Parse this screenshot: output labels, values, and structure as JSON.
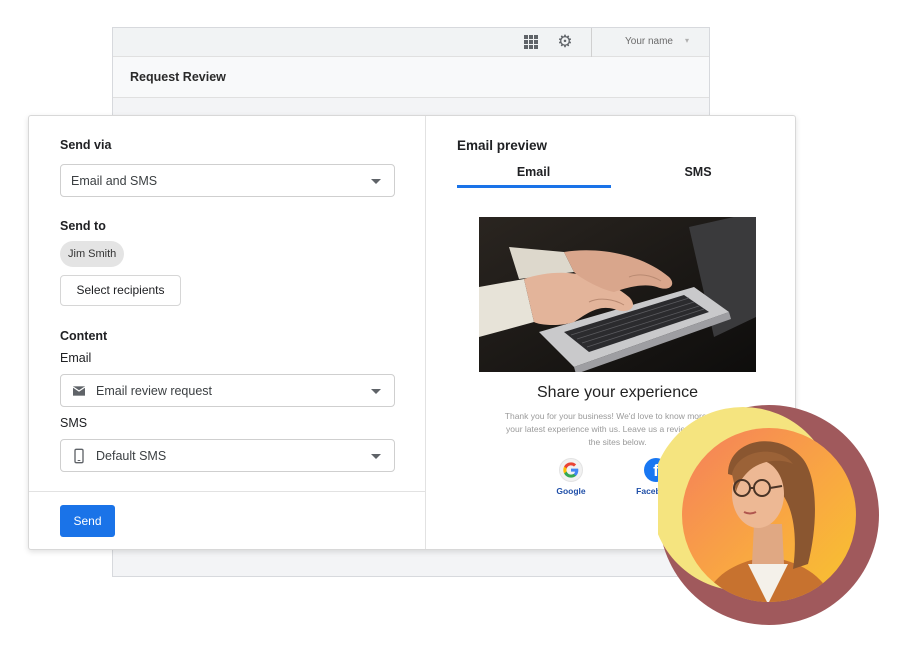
{
  "back_window": {
    "user_name": "Your name",
    "title": "Request Review"
  },
  "form": {
    "send_via_label": "Send via",
    "send_via_value": "Email and SMS",
    "send_to_label": "Send to",
    "recipient_chip": "Jim Smith",
    "select_recipients_label": "Select recipients",
    "content_label": "Content",
    "email_label": "Email",
    "email_value": "Email review request",
    "sms_label": "SMS",
    "sms_value": "Default SMS",
    "send_label": "Send"
  },
  "preview": {
    "title": "Email preview",
    "tabs": [
      "Email",
      "SMS"
    ],
    "active_tab": "Email",
    "heading": "Share your experience",
    "body": "Thank you for your business! We'd love to know more about your latest experience with us. Leave us a review on one of the sites below.",
    "sites": [
      {
        "name": "Google",
        "icon": "google-icon"
      },
      {
        "name": "Facebook",
        "icon": "facebook-icon"
      }
    ]
  },
  "colors": {
    "accent": "#1a73e8",
    "avatar_ring_outer": "#a0595c",
    "avatar_ring_inner": "#f5e47f",
    "avatar_bg": "#f7a24a"
  }
}
